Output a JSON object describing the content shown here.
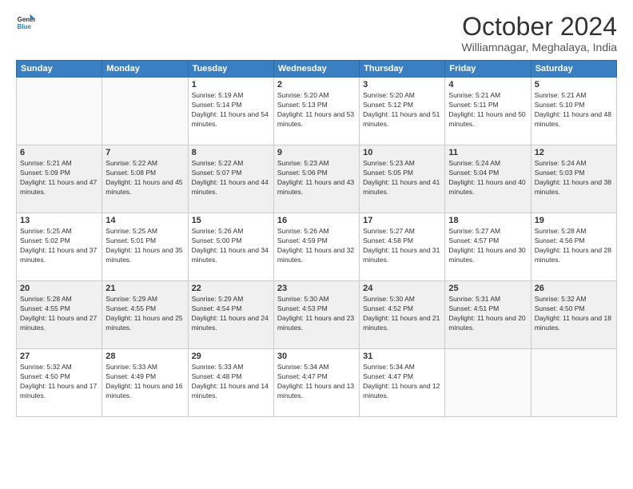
{
  "header": {
    "logo_line1": "General",
    "logo_line2": "Blue",
    "month": "October 2024",
    "location": "Williamnagar, Meghalaya, India"
  },
  "days_of_week": [
    "Sunday",
    "Monday",
    "Tuesday",
    "Wednesday",
    "Thursday",
    "Friday",
    "Saturday"
  ],
  "weeks": [
    [
      {
        "num": "",
        "info": ""
      },
      {
        "num": "",
        "info": ""
      },
      {
        "num": "1",
        "info": "Sunrise: 5:19 AM\nSunset: 5:14 PM\nDaylight: 11 hours and 54 minutes."
      },
      {
        "num": "2",
        "info": "Sunrise: 5:20 AM\nSunset: 5:13 PM\nDaylight: 11 hours and 53 minutes."
      },
      {
        "num": "3",
        "info": "Sunrise: 5:20 AM\nSunset: 5:12 PM\nDaylight: 11 hours and 51 minutes."
      },
      {
        "num": "4",
        "info": "Sunrise: 5:21 AM\nSunset: 5:11 PM\nDaylight: 11 hours and 50 minutes."
      },
      {
        "num": "5",
        "info": "Sunrise: 5:21 AM\nSunset: 5:10 PM\nDaylight: 11 hours and 48 minutes."
      }
    ],
    [
      {
        "num": "6",
        "info": "Sunrise: 5:21 AM\nSunset: 5:09 PM\nDaylight: 11 hours and 47 minutes."
      },
      {
        "num": "7",
        "info": "Sunrise: 5:22 AM\nSunset: 5:08 PM\nDaylight: 11 hours and 45 minutes."
      },
      {
        "num": "8",
        "info": "Sunrise: 5:22 AM\nSunset: 5:07 PM\nDaylight: 11 hours and 44 minutes."
      },
      {
        "num": "9",
        "info": "Sunrise: 5:23 AM\nSunset: 5:06 PM\nDaylight: 11 hours and 43 minutes."
      },
      {
        "num": "10",
        "info": "Sunrise: 5:23 AM\nSunset: 5:05 PM\nDaylight: 11 hours and 41 minutes."
      },
      {
        "num": "11",
        "info": "Sunrise: 5:24 AM\nSunset: 5:04 PM\nDaylight: 11 hours and 40 minutes."
      },
      {
        "num": "12",
        "info": "Sunrise: 5:24 AM\nSunset: 5:03 PM\nDaylight: 11 hours and 38 minutes."
      }
    ],
    [
      {
        "num": "13",
        "info": "Sunrise: 5:25 AM\nSunset: 5:02 PM\nDaylight: 11 hours and 37 minutes."
      },
      {
        "num": "14",
        "info": "Sunrise: 5:25 AM\nSunset: 5:01 PM\nDaylight: 11 hours and 35 minutes."
      },
      {
        "num": "15",
        "info": "Sunrise: 5:26 AM\nSunset: 5:00 PM\nDaylight: 11 hours and 34 minutes."
      },
      {
        "num": "16",
        "info": "Sunrise: 5:26 AM\nSunset: 4:59 PM\nDaylight: 11 hours and 32 minutes."
      },
      {
        "num": "17",
        "info": "Sunrise: 5:27 AM\nSunset: 4:58 PM\nDaylight: 11 hours and 31 minutes."
      },
      {
        "num": "18",
        "info": "Sunrise: 5:27 AM\nSunset: 4:57 PM\nDaylight: 11 hours and 30 minutes."
      },
      {
        "num": "19",
        "info": "Sunrise: 5:28 AM\nSunset: 4:56 PM\nDaylight: 11 hours and 28 minutes."
      }
    ],
    [
      {
        "num": "20",
        "info": "Sunrise: 5:28 AM\nSunset: 4:55 PM\nDaylight: 11 hours and 27 minutes."
      },
      {
        "num": "21",
        "info": "Sunrise: 5:29 AM\nSunset: 4:55 PM\nDaylight: 11 hours and 25 minutes."
      },
      {
        "num": "22",
        "info": "Sunrise: 5:29 AM\nSunset: 4:54 PM\nDaylight: 11 hours and 24 minutes."
      },
      {
        "num": "23",
        "info": "Sunrise: 5:30 AM\nSunset: 4:53 PM\nDaylight: 11 hours and 23 minutes."
      },
      {
        "num": "24",
        "info": "Sunrise: 5:30 AM\nSunset: 4:52 PM\nDaylight: 11 hours and 21 minutes."
      },
      {
        "num": "25",
        "info": "Sunrise: 5:31 AM\nSunset: 4:51 PM\nDaylight: 11 hours and 20 minutes."
      },
      {
        "num": "26",
        "info": "Sunrise: 5:32 AM\nSunset: 4:50 PM\nDaylight: 11 hours and 18 minutes."
      }
    ],
    [
      {
        "num": "27",
        "info": "Sunrise: 5:32 AM\nSunset: 4:50 PM\nDaylight: 11 hours and 17 minutes."
      },
      {
        "num": "28",
        "info": "Sunrise: 5:33 AM\nSunset: 4:49 PM\nDaylight: 11 hours and 16 minutes."
      },
      {
        "num": "29",
        "info": "Sunrise: 5:33 AM\nSunset: 4:48 PM\nDaylight: 11 hours and 14 minutes."
      },
      {
        "num": "30",
        "info": "Sunrise: 5:34 AM\nSunset: 4:47 PM\nDaylight: 11 hours and 13 minutes."
      },
      {
        "num": "31",
        "info": "Sunrise: 5:34 AM\nSunset: 4:47 PM\nDaylight: 11 hours and 12 minutes."
      },
      {
        "num": "",
        "info": ""
      },
      {
        "num": "",
        "info": ""
      }
    ]
  ]
}
